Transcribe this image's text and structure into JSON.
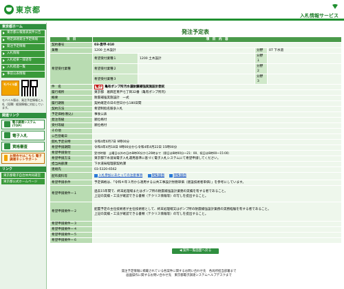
{
  "header": {
    "logo_text": "東京都",
    "service_title": "入札情報サービス"
  },
  "sidebar": {
    "section1_title": "東京都ホーム",
    "links": [
      "東京都公報発表案件公告",
      "特定調達発注予定情報",
      "発注予定情報",
      "入札情報",
      "入札結果・辞退等",
      "入札経過一覧",
      "事前公表情報"
    ],
    "mobile_badge": "モバイル版",
    "mobile_note": "モバイル版は、発注予定情報と入札（見積）経過情報に対応しています。",
    "section2_title": "関連リンク",
    "buttons": [
      "電子調達システム(TOP)",
      "電子入札",
      "資格審査"
    ],
    "help_button": "お問合せはこちら 電子調達ネットサポート",
    "section3_title": "リンク",
    "bottom_links": [
      "東京都電子自治体共同運営",
      "東京都公式ホームページ"
    ]
  },
  "page": {
    "title": "発注予定表",
    "col_item": "項　目",
    "col_content": "項　目　内　容",
    "rows": {
      "keiyaku_no_label": "契約番号",
      "keiyaku_no": "03-委甲-010",
      "gyoshu_label": "業種",
      "gyoshu": "1200 土木設計",
      "bunya_label": "分野",
      "bunya": "07 下水道",
      "kibo_label": "希望受付業種",
      "kibo1_label": "希望受付業種１",
      "kibo1": "1200 土木設計",
      "kibo2_label": "希望受付業種２",
      "kibo3_label": "希望受付業種３",
      "field1_label": "分野１",
      "field2_label": "分野２",
      "field3_label": "分野３",
      "kenmei_label": "件　名",
      "kenmei_tag": "電子",
      "kenmei": "亀有ポンプ所汚水還耐震補強実施設計委託",
      "rikou_label": "履行場所",
      "rikou": "東京都　葛飾区青戸七丁目32番（亀有ポンプ所内）",
      "gaiyo_label": "概要",
      "gaiyo": "耐震補強実施設計　一式",
      "kigen_label": "履行期限",
      "kigen": "契約確定の日の翌日から180日間",
      "hoho_label": "契約方法",
      "hoho": "希望制指名競争入札",
      "yotei_label": "予定価格(税込)",
      "yotei": "事後公表",
      "hassho_label": "発注等級",
      "hassho": "順位格付",
      "uketsuke_label": "受付等級",
      "uketsuke": "順位格付",
      "sonota_label": "その他",
      "sonota": "",
      "koukoku_label": "公告登載日",
      "koukoku": "",
      "kaisatsu_label": "開札予定日時",
      "kaisatsu": "令和4年6月7日 9時00分",
      "shinsei_label": "希望申請期間",
      "shinsei": "令和4年4月18日 9時00分から令和4年4月22日 15時00分",
      "uketsukeJ_label": "希望申請受付",
      "uketsukeJ": "受付時間　土曜日以外の日の8時00分から20時まで（昼日は8時00分〜21：00、祝日は8時00〜15:00）",
      "hoho2_label": "希望申請方法",
      "hoho2": "東京都下水道局電子入札運用基準に基づく電子入札システムにて希望申請してください。",
      "tantou_label": "担当局部課",
      "tantou": "下水道局経理部契約課",
      "renraku_label": "連絡先",
      "renraku": "03-5320-6562",
      "haifu_label": "配布資料等",
      "haifu1": "入札参加にあたっての注意事項",
      "haifu2": "閲覧図面",
      "haifu3": "閲覧図面",
      "jouken_label": "希望申請条件",
      "jouken": "予定価格は、「令和４年３月から適用する公共工事設計労務単価（建設技術者単価）」を参考にしています。",
      "y1_label": "希望申請要件ー１",
      "y1": "過去15年間で、終末処理場またはポンプ所の耐震補強設計業務の実績を有する者であること。\n上記の実績・工法が確認できる書類（テクリス情報等）の写しを提出すること。",
      "y2_label": "希望申請要件ー２",
      "y2": "配置予定の主任技術者が主任技術者として、終末処理場又はポンプ所の耐震補強設計業務の実務経験を有する者であること。\n上記の実績・工法が確認できる書類（テクリス情報等）の写しを提出すること。",
      "y3_label": "希望申請要件ー３",
      "y4_label": "希望申請要件ー４",
      "y5_label": "希望申請要件ー５",
      "y6_label": "希望申請要件ー６"
    },
    "back_button": "◀ 案件一覧画面へ戻る"
  },
  "footer": {
    "line1": "発注予定情報に掲載されている各案件に関するお問い合わせ先　各局所担当部署まで",
    "line2": "画面操作に関するお問い合わせ先　東京都電子調達システムヘルプデスクまで"
  },
  "colors": {
    "brand_green": "#1f8f2f",
    "label_bg": "#b9dcb2",
    "value_bg": "#eef7ec"
  }
}
